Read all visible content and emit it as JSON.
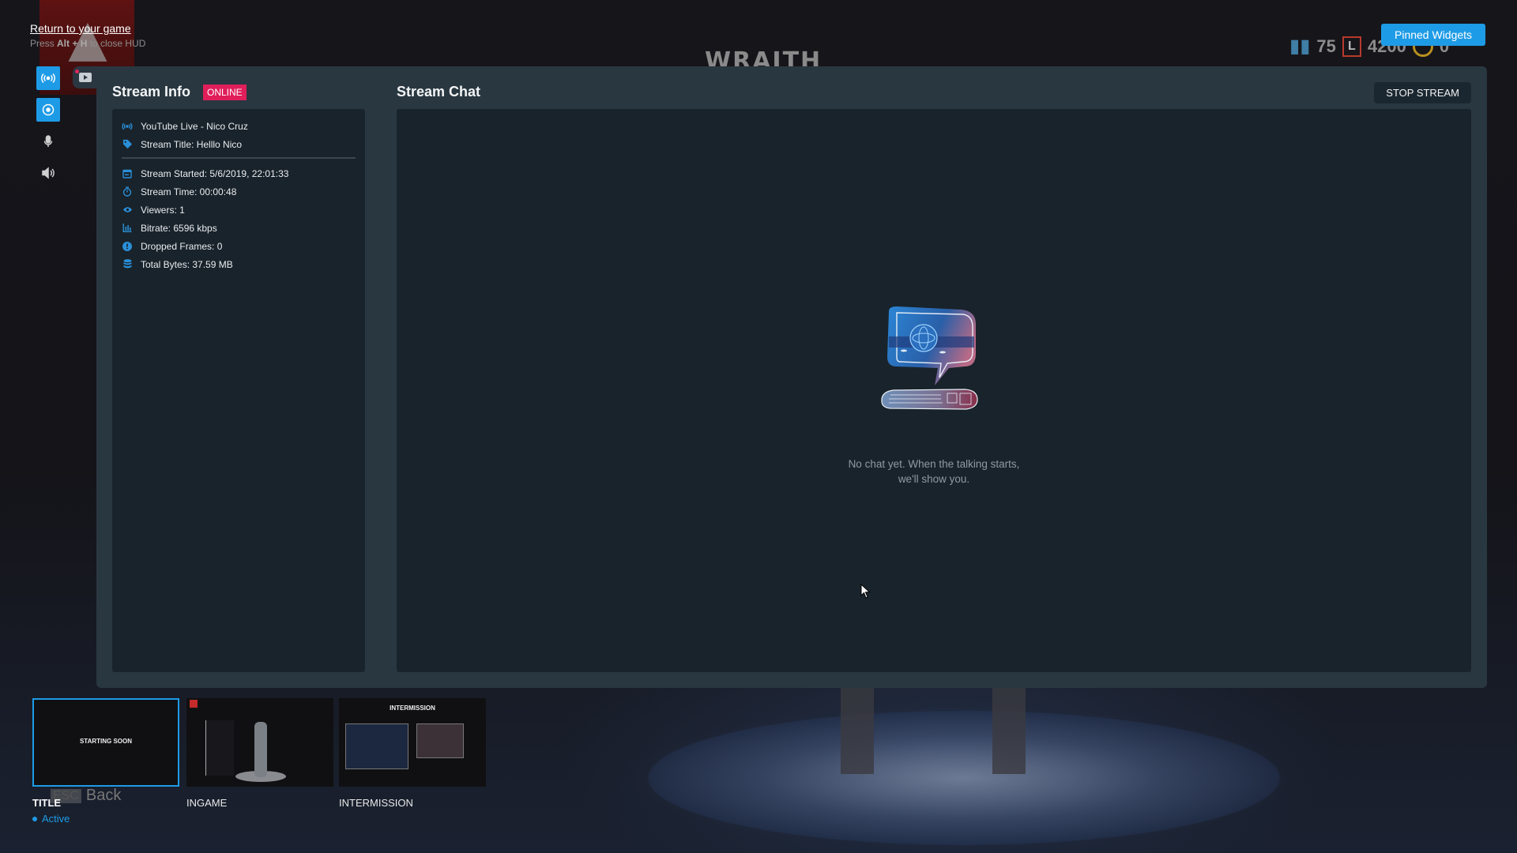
{
  "hud": {
    "return_link": "Return to your game",
    "close_hint_prefix": "Press ",
    "close_hint_keys": "Alt + H",
    "close_hint_suffix": " to close HUD",
    "pinned_widgets_label": "Pinned Widgets"
  },
  "background": {
    "legend_name": "WRAITH",
    "stat_crafting": "75",
    "stat_legend_tokens": "4200",
    "stat_coins": "0",
    "esc_key": "ESC",
    "back_label": "Back"
  },
  "rail": {
    "items": [
      {
        "icon": "broadcast-icon",
        "active": true
      },
      {
        "icon": "record-icon",
        "active": true
      },
      {
        "icon": "microphone-icon",
        "active": false
      },
      {
        "icon": "speaker-icon",
        "active": false
      }
    ]
  },
  "tabs": {
    "youtube_icon": "youtube-icon"
  },
  "stream_info": {
    "title": "Stream Info",
    "status_badge": "ONLINE",
    "platform": "YouTube Live - Nico Cruz",
    "stream_title": "Stream Title: Helllo Nico",
    "stats": [
      {
        "icon": "calendar-icon",
        "text": "Stream Started: 5/6/2019, 22:01:33"
      },
      {
        "icon": "stopwatch-icon",
        "text": "Stream Time: 00:00:48"
      },
      {
        "icon": "eye-icon",
        "text": "Viewers: 1"
      },
      {
        "icon": "bar-chart-icon",
        "text": "Bitrate: 6596 kbps"
      },
      {
        "icon": "alert-circle-icon",
        "text": "Dropped Frames: 0"
      },
      {
        "icon": "database-icon",
        "text": "Total Bytes: 37.59 MB"
      }
    ]
  },
  "stream_chat": {
    "title": "Stream Chat",
    "stop_button": "STOP STREAM",
    "empty_line1": "No chat yet. When the talking starts,",
    "empty_line2": "we'll show you."
  },
  "scenes": [
    {
      "label": "TITLE",
      "thumb_text": "STARTING SOON",
      "active": true,
      "status": "Active"
    },
    {
      "label": "INGAME",
      "active": false
    },
    {
      "label": "INTERMISSION",
      "thumb_text": "INTERMISSION",
      "active": false
    }
  ],
  "colors": {
    "accent": "#1e9be6",
    "online": "#e01e5a",
    "panel": "#293740",
    "card": "#19232b"
  }
}
